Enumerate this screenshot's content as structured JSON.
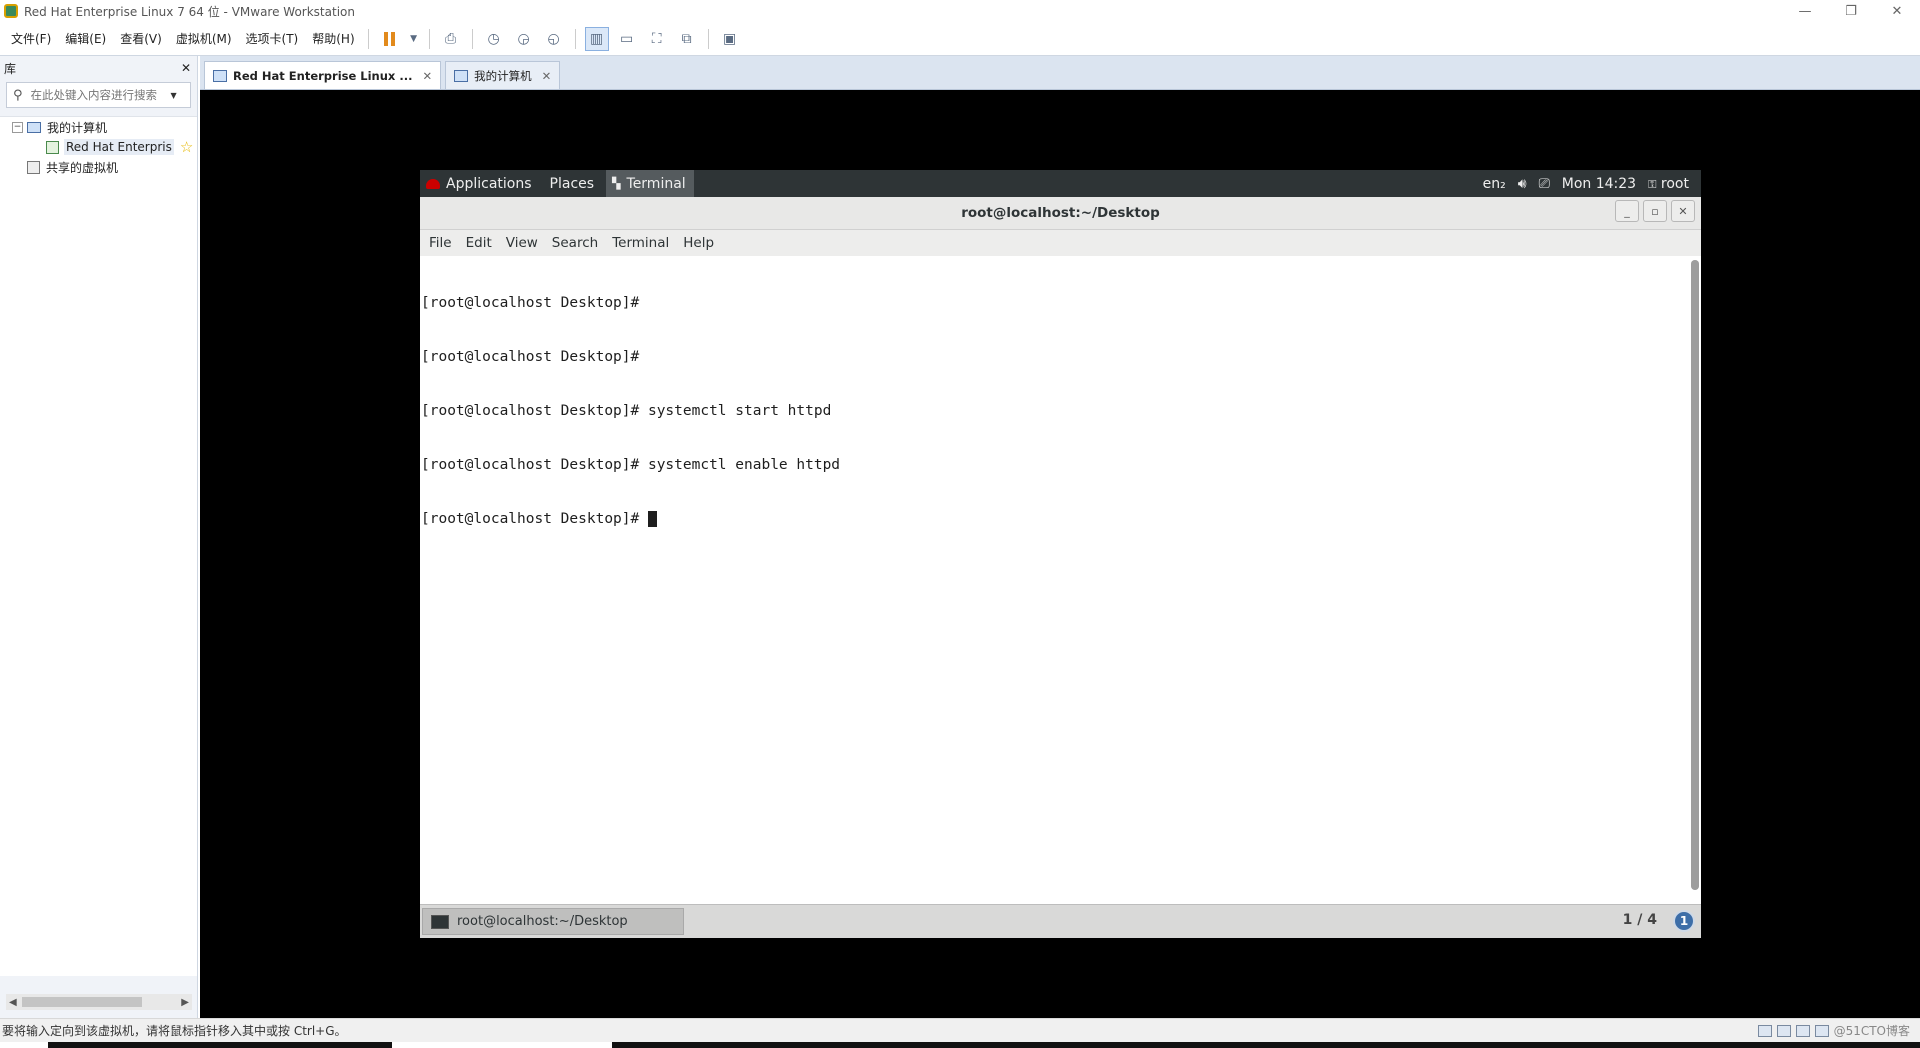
{
  "window": {
    "title": "Red Hat Enterprise Linux 7 64 位 - VMware Workstation",
    "controls": [
      "—",
      "❐",
      "✕"
    ]
  },
  "menubar": {
    "items": [
      "文件(F)",
      "编辑(E)",
      "查看(V)",
      "虚拟机(M)",
      "选项卡(T)",
      "帮助(H)"
    ]
  },
  "library": {
    "title": "库",
    "close": "✕",
    "search_placeholder": "在此处键入内容进行搜索",
    "tree": {
      "my_computer": "我的计算机",
      "vm_item": "Red Hat Enterpris",
      "shared": "共享的虚拟机"
    }
  },
  "tabs": [
    {
      "label": "Red Hat Enterprise Linux ...",
      "close": "✕",
      "active": true
    },
    {
      "label": "我的计算机",
      "close": "✕",
      "active": false
    }
  ],
  "guest": {
    "top_panel": {
      "applications": "Applications",
      "places": "Places",
      "active_app": "Terminal",
      "keyboard": "en₂",
      "clock": "Mon 14:23",
      "user": "root"
    },
    "terminal": {
      "title": "root@localhost:~/Desktop",
      "menu": [
        "File",
        "Edit",
        "View",
        "Search",
        "Terminal",
        "Help"
      ],
      "lines": [
        "[root@localhost Desktop]#",
        "[root@localhost Desktop]#",
        "[root@localhost Desktop]# systemctl start httpd",
        "[root@localhost Desktop]# systemctl enable httpd",
        "[root@localhost Desktop]# "
      ]
    },
    "bottom_panel": {
      "task_label": "root@localhost:~/Desktop",
      "workspace": "1 / 4",
      "notification_count": "1"
    }
  },
  "statusbar": {
    "message": "要将输入定向到该虚拟机，请将鼠标指针移入其中或按 Ctrl+G。",
    "watermark": "@51CTO博客"
  }
}
